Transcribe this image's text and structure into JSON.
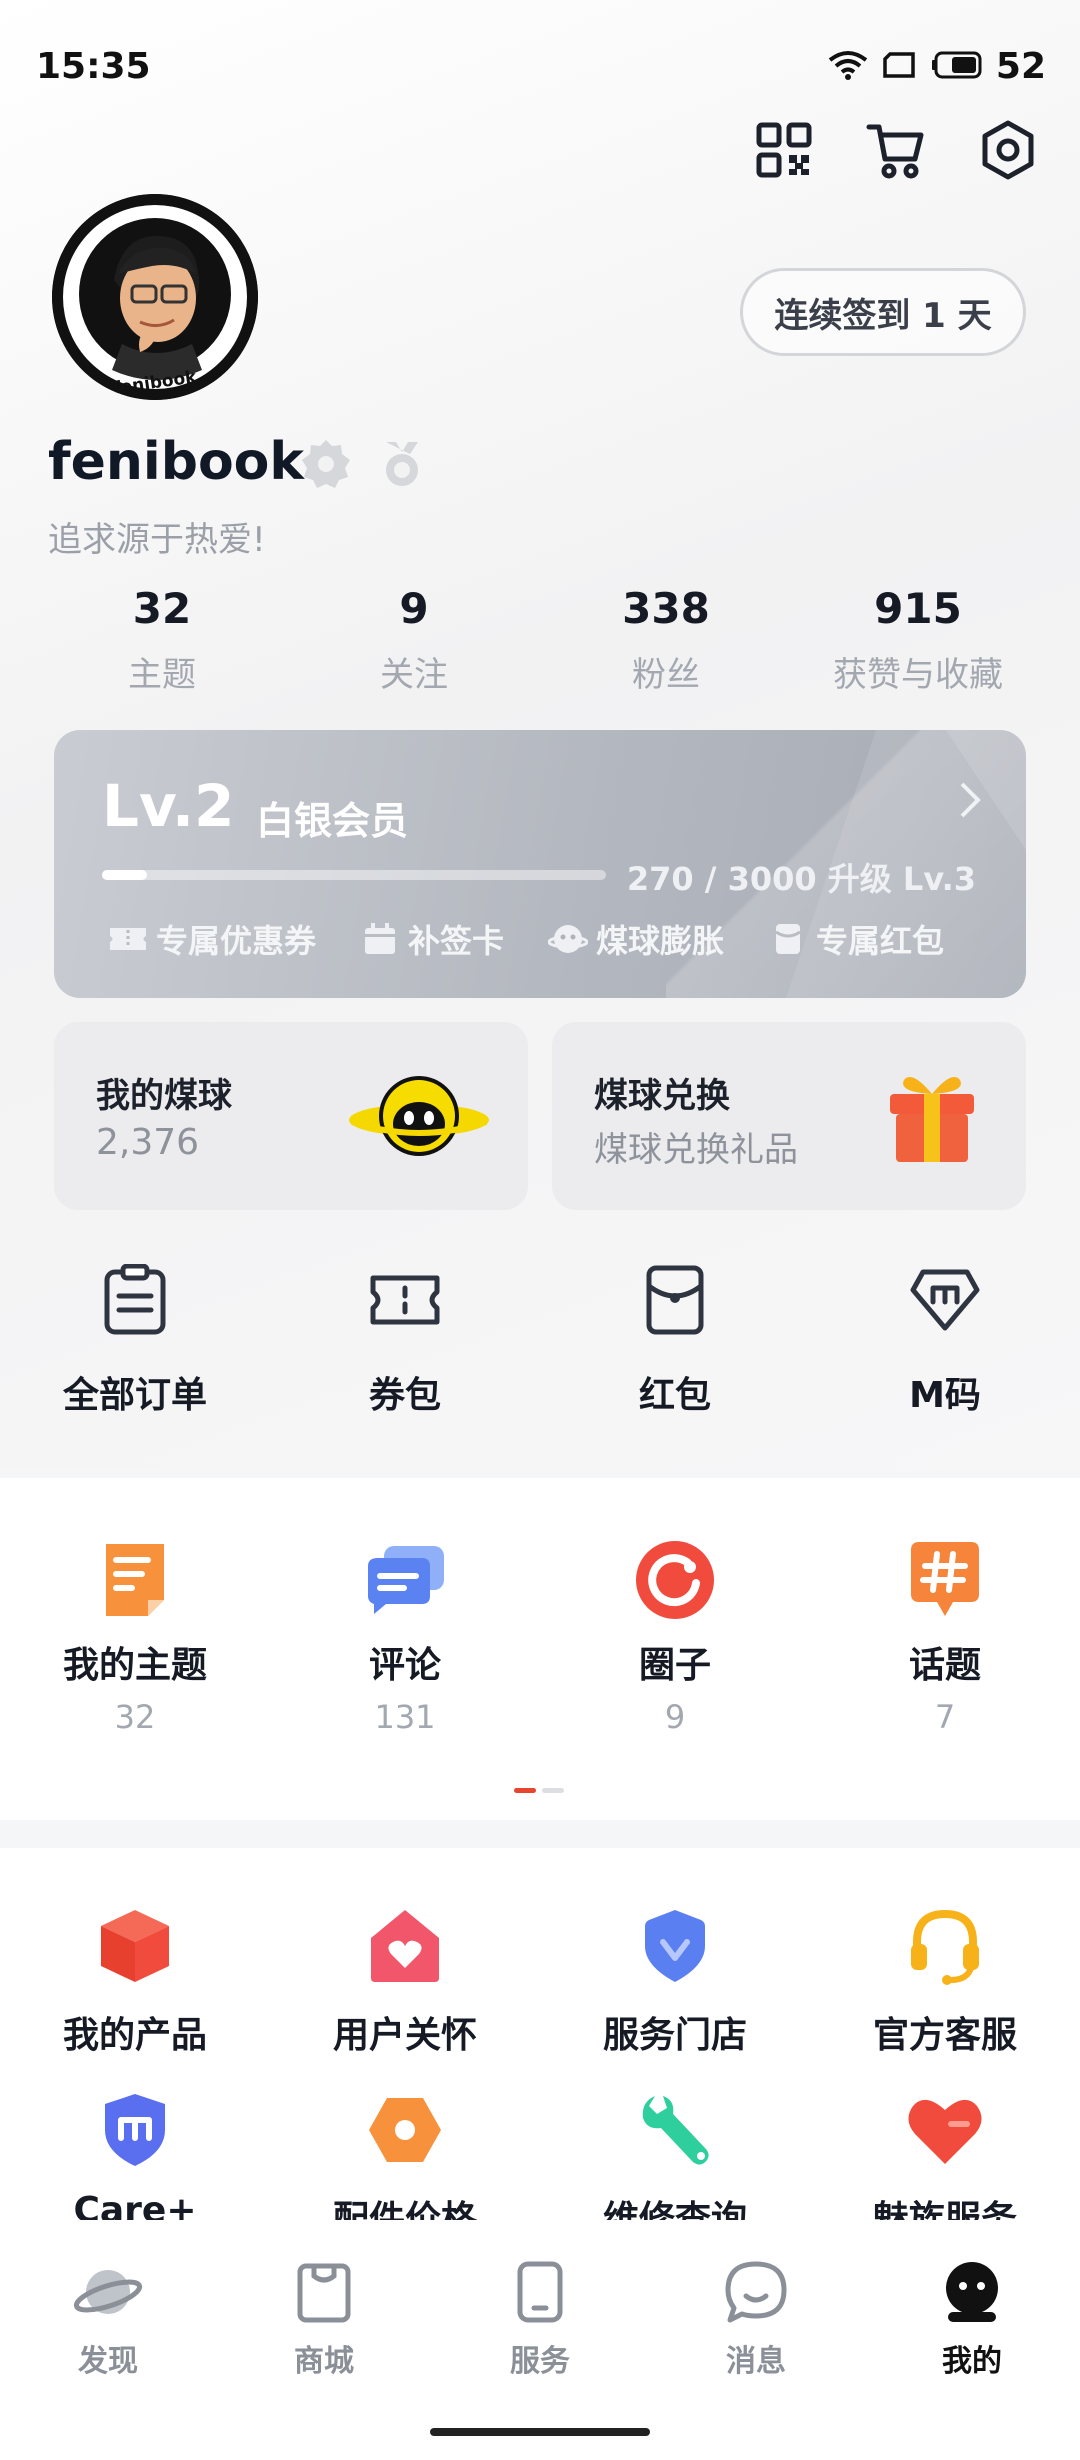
{
  "status_bar": {
    "time": "15:35",
    "battery": "52"
  },
  "top_actions": {
    "qr_icon": "qr-code-icon",
    "cart_icon": "cart-icon",
    "settings_icon": "settings-icon"
  },
  "profile": {
    "avatar_caption": "fenibook",
    "username": "fenibook",
    "bio": "追求源于热爱!",
    "signin_label": "连续签到 1 天"
  },
  "stats": [
    {
      "value": "32",
      "label": "主题"
    },
    {
      "value": "9",
      "label": "关注"
    },
    {
      "value": "338",
      "label": "粉丝"
    },
    {
      "value": "915",
      "label": "获赞与收藏"
    }
  ],
  "level": {
    "level_text": "Lv.2",
    "tier": "白银会员",
    "progress_text": "270 / 3000 升级 Lv.3",
    "progress_fraction": 0.09,
    "perks": [
      "专属优惠券",
      "补签卡",
      "煤球膨胀",
      "专属红包"
    ]
  },
  "coin_card": {
    "title": "我的煤球",
    "value": "2,376"
  },
  "exchange_card": {
    "title": "煤球兑换",
    "subtitle": "煤球兑换礼品"
  },
  "quick_links": [
    "全部订单",
    "券包",
    "红包",
    "M码"
  ],
  "content": [
    {
      "label": "我的主题",
      "count": "32",
      "color": "#f7913b"
    },
    {
      "label": "评论",
      "count": "131",
      "color": "#5a82f0"
    },
    {
      "label": "圈子",
      "count": "9",
      "color": "#f04b3c"
    },
    {
      "label": "话题",
      "count": "7",
      "color": "#f6843a"
    }
  ],
  "services_row1": [
    {
      "label": "我的产品",
      "color": "#f04b3c"
    },
    {
      "label": "用户关怀",
      "color": "#f2566a"
    },
    {
      "label": "服务门店",
      "color": "#5a7ff0"
    },
    {
      "label": "官方客服",
      "color": "#f7b21a"
    }
  ],
  "services_row2": [
    {
      "label": "Care+",
      "color": "#5a6ef0"
    },
    {
      "label": "配件价格",
      "color": "#f7913b"
    },
    {
      "label": "维修查询",
      "color": "#2ecf9c"
    },
    {
      "label": "魅族服务",
      "color": "#f04b3c"
    }
  ],
  "bottom_nav": [
    "发现",
    "商城",
    "服务",
    "消息",
    "我的"
  ]
}
